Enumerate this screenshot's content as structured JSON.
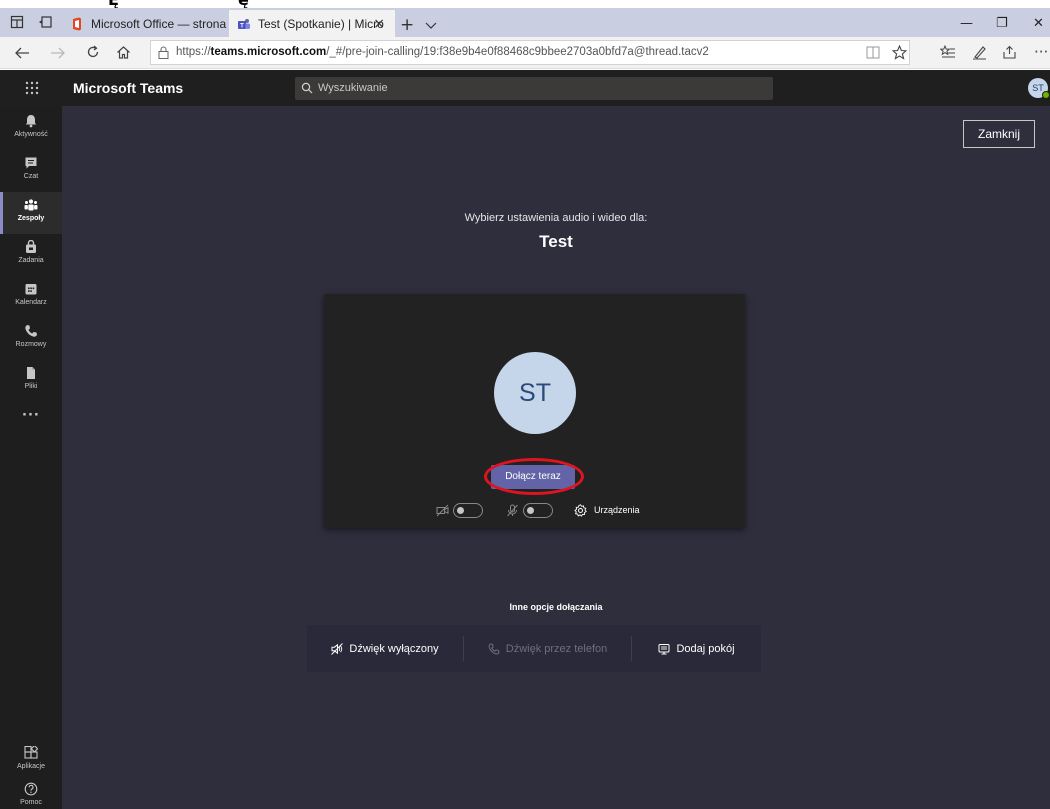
{
  "top_strip": {
    "fragment_a": "Ę",
    "fragment_b": "ę"
  },
  "browser": {
    "tabs": [
      {
        "title": "Microsoft Office — strona g",
        "icon": "office-icon",
        "active": false
      },
      {
        "title": "Test (Spotkanie) | Micro",
        "icon": "teams-icon",
        "active": true
      }
    ],
    "new_tab": "+",
    "close_tab": "×",
    "url_prefix": "https://",
    "url_host": "teams.microsoft.com",
    "url_path": "/_#/pre-join-calling/19:f38e9b4e0f88468c9bbee2703a0bfd7a@thread.tacv2",
    "window_controls": {
      "minimize": "—",
      "restore": "❐",
      "close": "✕"
    },
    "more": "···"
  },
  "teams": {
    "app_name": "Microsoft Teams",
    "search_placeholder": "Wyszukiwanie",
    "user_initials": "ST",
    "accent_color": "#6264a7",
    "rail": [
      {
        "label": "Aktywność",
        "icon": "bell-icon",
        "active": false
      },
      {
        "label": "Czat",
        "icon": "chat-icon",
        "active": false
      },
      {
        "label": "Zespoły",
        "icon": "teams-group-icon",
        "active": true
      },
      {
        "label": "Zadania",
        "icon": "bag-icon",
        "active": false
      },
      {
        "label": "Kalendarz",
        "icon": "calendar-icon",
        "active": false
      },
      {
        "label": "Rozmowy",
        "icon": "phone-icon",
        "active": false
      },
      {
        "label": "Pliki",
        "icon": "file-icon",
        "active": false
      }
    ],
    "rail_more": "···",
    "rail_bottom": [
      {
        "label": "Aplikacje",
        "icon": "apps-icon"
      },
      {
        "label": "Pomoc",
        "icon": "help-icon"
      }
    ],
    "close_button": "Zamknij",
    "prompt": "Wybierz ustawienia audio i wideo dla:",
    "meeting_title": "Test",
    "preview_initials": "ST",
    "join_button": "Dołącz teraz",
    "devices_label": "Urządzenia",
    "video_on": false,
    "mic_on": false,
    "other_options_label": "Inne opcje dołączania",
    "options": [
      {
        "label": "Dźwięk wyłączony",
        "icon": "speaker-off-icon",
        "enabled": true
      },
      {
        "label": "Dźwięk przez telefon",
        "icon": "phone-icon",
        "enabled": false
      },
      {
        "label": "Dodaj pokój",
        "icon": "room-icon",
        "enabled": true
      }
    ]
  }
}
